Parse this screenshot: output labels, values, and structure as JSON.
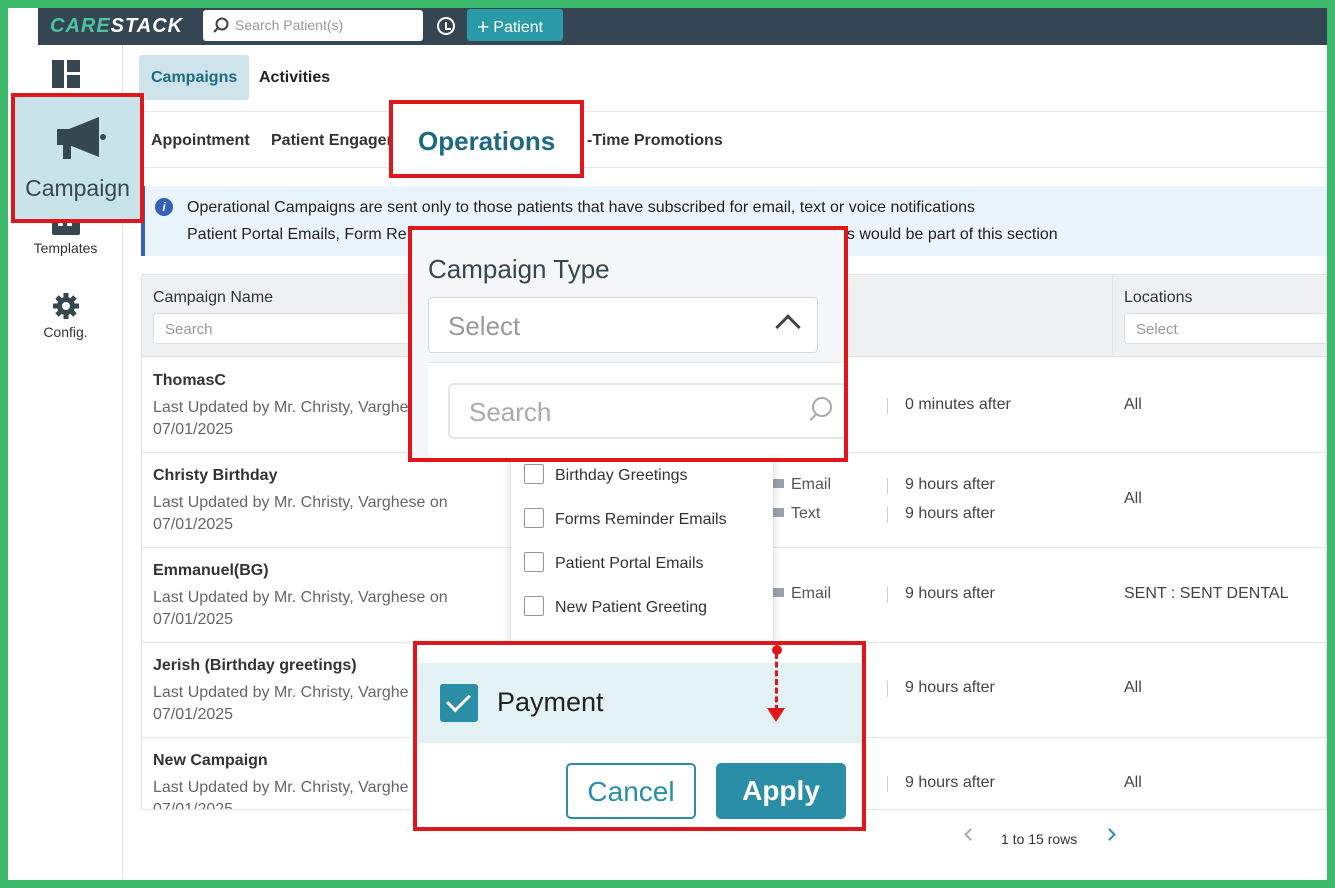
{
  "app": {
    "logo_main": "CARE",
    "logo_accent": "STACK",
    "search_placeholder": "Search Patient(s)",
    "add_patient_label": "Patient"
  },
  "sidebar": {
    "campaign_label": "Campaign",
    "templates_label": "Templates",
    "config_label": "Config."
  },
  "tabs": {
    "campaigns": "Campaigns",
    "activities": "Activities"
  },
  "subtabs": {
    "appointment": "Appointment",
    "patient_engagement": "Patient Engager",
    "operations": "Operations",
    "one_time": "-Time Promotions"
  },
  "info": {
    "line1": "Operational Campaigns are sent only to those patients that have subscribed for email, text or voice notifications",
    "line2_start": "Patient Portal Emails, Form Re",
    "line2_end": "gs would be part of this section"
  },
  "table": {
    "col_name": "Campaign Name",
    "col_name_placeholder": "Search",
    "col_locations": "Locations",
    "col_locations_placeholder": "Select",
    "rows": [
      {
        "name": "ThomasC",
        "meta1": "Last Updated by Mr. Christy, Varghe",
        "meta2": "07/01/2025",
        "ch1": "",
        "time1": "0 minutes after",
        "ch2": "",
        "time2": "",
        "loc": "All"
      },
      {
        "name": "Christy Birthday",
        "meta1": "Last Updated by Mr. Christy, Varghese on",
        "meta2": "07/01/2025",
        "ch1": "Email",
        "time1": "9 hours after",
        "ch2": "Text",
        "time2": "9 hours after",
        "loc": "All"
      },
      {
        "name": "Emmanuel(BG)",
        "meta1": "Last Updated by Mr. Christy, Varghese on",
        "meta2": "07/01/2025",
        "ch1": "Email",
        "time1": "9 hours after",
        "ch2": "",
        "time2": "",
        "loc": "SENT : SENT DENTAL"
      },
      {
        "name": "Jerish (Birthday greetings)",
        "meta1": "Last Updated by Mr. Christy, Varghe",
        "meta2": "07/01/2025",
        "ch1": "",
        "time1": "9 hours after",
        "ch2": "",
        "time2": "",
        "loc": "All"
      },
      {
        "name": "New Campaign",
        "meta1": "Last Updated by Mr. Christy, Varghe",
        "meta2": "07/01/2025",
        "ch1": "",
        "time1": "9 hours after",
        "ch2": "",
        "time2": "",
        "loc": "All"
      }
    ]
  },
  "campaign_type": {
    "title": "Campaign Type",
    "select_placeholder": "Select",
    "search_placeholder": "Search",
    "options": [
      "Birthday Greetings",
      "Forms Reminder Emails",
      "Patient Portal Emails",
      "New Patient Greeting"
    ],
    "selected_option": "Payment",
    "cancel_label": "Cancel",
    "apply_label": "Apply"
  },
  "pager": {
    "text": "1 to 15 rows"
  },
  "colors": {
    "accent": "#2a8fa6",
    "highlight": "#e0161b",
    "topbar": "#344654",
    "border": "#3cb86a"
  }
}
